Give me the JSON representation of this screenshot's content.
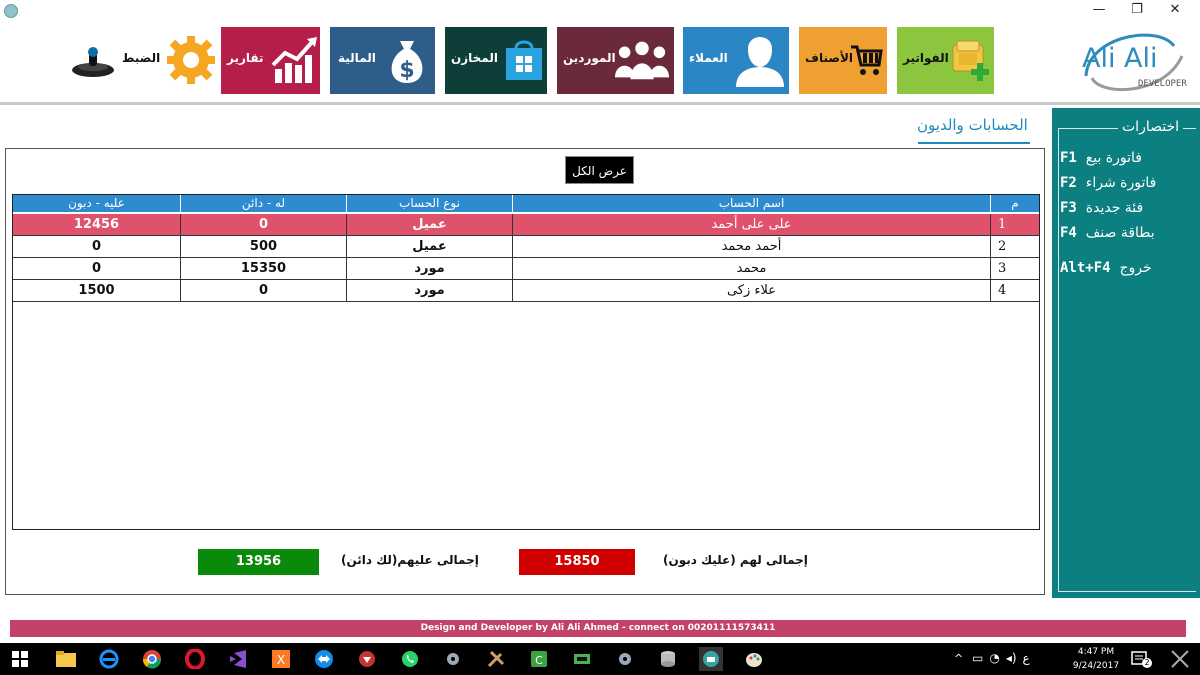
{
  "window": {
    "min_glyph": "—",
    "max_glyph": "❐",
    "close_glyph": "✕"
  },
  "logo": {
    "title": "Ali Ali",
    "subtitle": "DEVELOPER"
  },
  "ribbon": {
    "settings": "الضبط",
    "reports": "تقارير",
    "finance": "المالية",
    "stores": "المخازن",
    "suppliers": "الموردين",
    "customers": "العملاء",
    "items": "الأصناف",
    "invoices": "الفواتير"
  },
  "page": {
    "title": "الحسابات والديون",
    "show_all": "عرض الكل"
  },
  "grid": {
    "headers": {
      "no": "م",
      "account_name": "اسم الحساب",
      "account_type": "نوع الحساب",
      "credit": "له - دائن",
      "debit": "عليه - دبون"
    },
    "rows": [
      {
        "no": "1",
        "name": "على على أحمد",
        "type": "عميل",
        "credit": "0",
        "debit": "12456"
      },
      {
        "no": "2",
        "name": "أحمد محمد",
        "type": "عميل",
        "credit": "500",
        "debit": "0"
      },
      {
        "no": "3",
        "name": "محمد",
        "type": "مورد",
        "credit": "15350",
        "debit": "0"
      },
      {
        "no": "4",
        "name": "علاء زكى",
        "type": "مورد",
        "credit": "0",
        "debit": "1500"
      }
    ]
  },
  "totals": {
    "for_them_label": "إجمالى لهم (عليك دبون)",
    "for_them_value": "15850",
    "on_them_label": "إجمالى عليهم(لك دائن)",
    "on_them_value": "13956"
  },
  "shortcuts": {
    "title": "اختصارات",
    "items": [
      {
        "text": "فاتورة بيع",
        "key": "F1"
      },
      {
        "text": "فاتورة شراء",
        "key": "F2"
      },
      {
        "text": "فئة جديدة",
        "key": "F3"
      },
      {
        "text": "بطاقة صنف",
        "key": "F4"
      },
      {
        "text": "خروج",
        "key": "Alt+F4"
      }
    ]
  },
  "footer": "Design and Developer by Ali Ali Ahmed - connect on 00201111573411",
  "taskbar": {
    "lang": "ع",
    "time": "4:47 PM",
    "date": "9/24/2017",
    "notif": "2"
  },
  "colors": {
    "header_blue": "#2f8bd0",
    "selected_row": "#e0516c",
    "shortcut_panel": "#0c7f80",
    "total_red": "#d10000",
    "total_green": "#0a8a0a"
  }
}
